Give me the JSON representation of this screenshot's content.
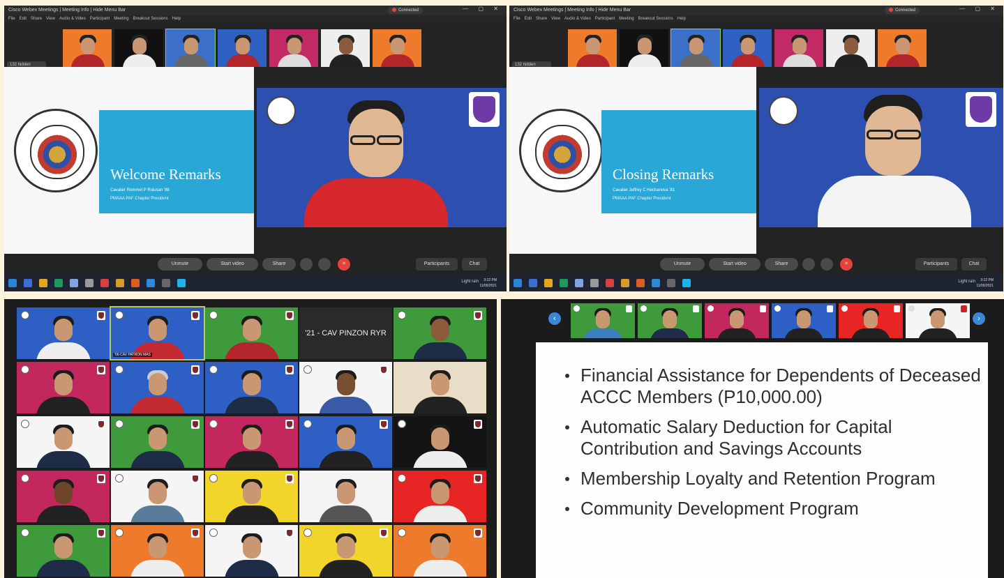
{
  "windows": [
    {
      "title": "Cisco Webex Meetings  |  Meeting Info  |  Hide Menu Bar",
      "menu": [
        "File",
        "Edit",
        "Share",
        "View",
        "Audio & Video",
        "Participant",
        "Meeting",
        "Breakout Sessions",
        "Help"
      ],
      "status": "Connected",
      "hold_label": "132 hidden",
      "slide_title": "Welcome Remarks",
      "slide_line1": "Cavalier Rommel P Rolusan '88",
      "slide_line2": "PMAAA PAF Chapter President",
      "controls": {
        "unmute": "Unmute",
        "video": "Start video",
        "share": "Share",
        "participants": "Participants",
        "chat": "Chat"
      },
      "tray": "Light rain",
      "clock_time": "3:22 PM",
      "clock_date": "11/06/2021"
    },
    {
      "title": "Cisco Webex Meetings  |  Meeting Info  |  Hide Menu Bar",
      "menu": [
        "File",
        "Edit",
        "Share",
        "View",
        "Audio & Video",
        "Participant",
        "Meeting",
        "Breakout Sessions",
        "Help"
      ],
      "status": "Connected",
      "hold_label": "132 hidden",
      "slide_title": "Closing Remarks",
      "slide_line1": "Cavalier Jeffrey C Hechanova '81",
      "slide_line2": "PMAAA PAF Chapter President",
      "controls": {
        "unmute": "Unmute",
        "video": "Start video",
        "share": "Share",
        "participants": "Participants",
        "chat": "Chat"
      },
      "tray": "Light rain",
      "clock_time": "3:22 PM",
      "clock_date": "11/06/2021"
    }
  ],
  "grid": {
    "name_tile": "'21 - CAV PINZON RYR",
    "caption": "'06-CAV PATRON MAS"
  },
  "slide_bullets": [
    "Financial Assistance for Dependents of Deceased ACCC Members (P10,000.00)",
    "Automatic Salary Deduction for Capital Contribution and Savings Accounts",
    "Membership Loyalty and Retention Program",
    "Community Development Program"
  ],
  "colors": {
    "accent_blue": "#2c4fb0",
    "slide_cyan": "#29a7d6",
    "end_red": "#e6413a"
  }
}
